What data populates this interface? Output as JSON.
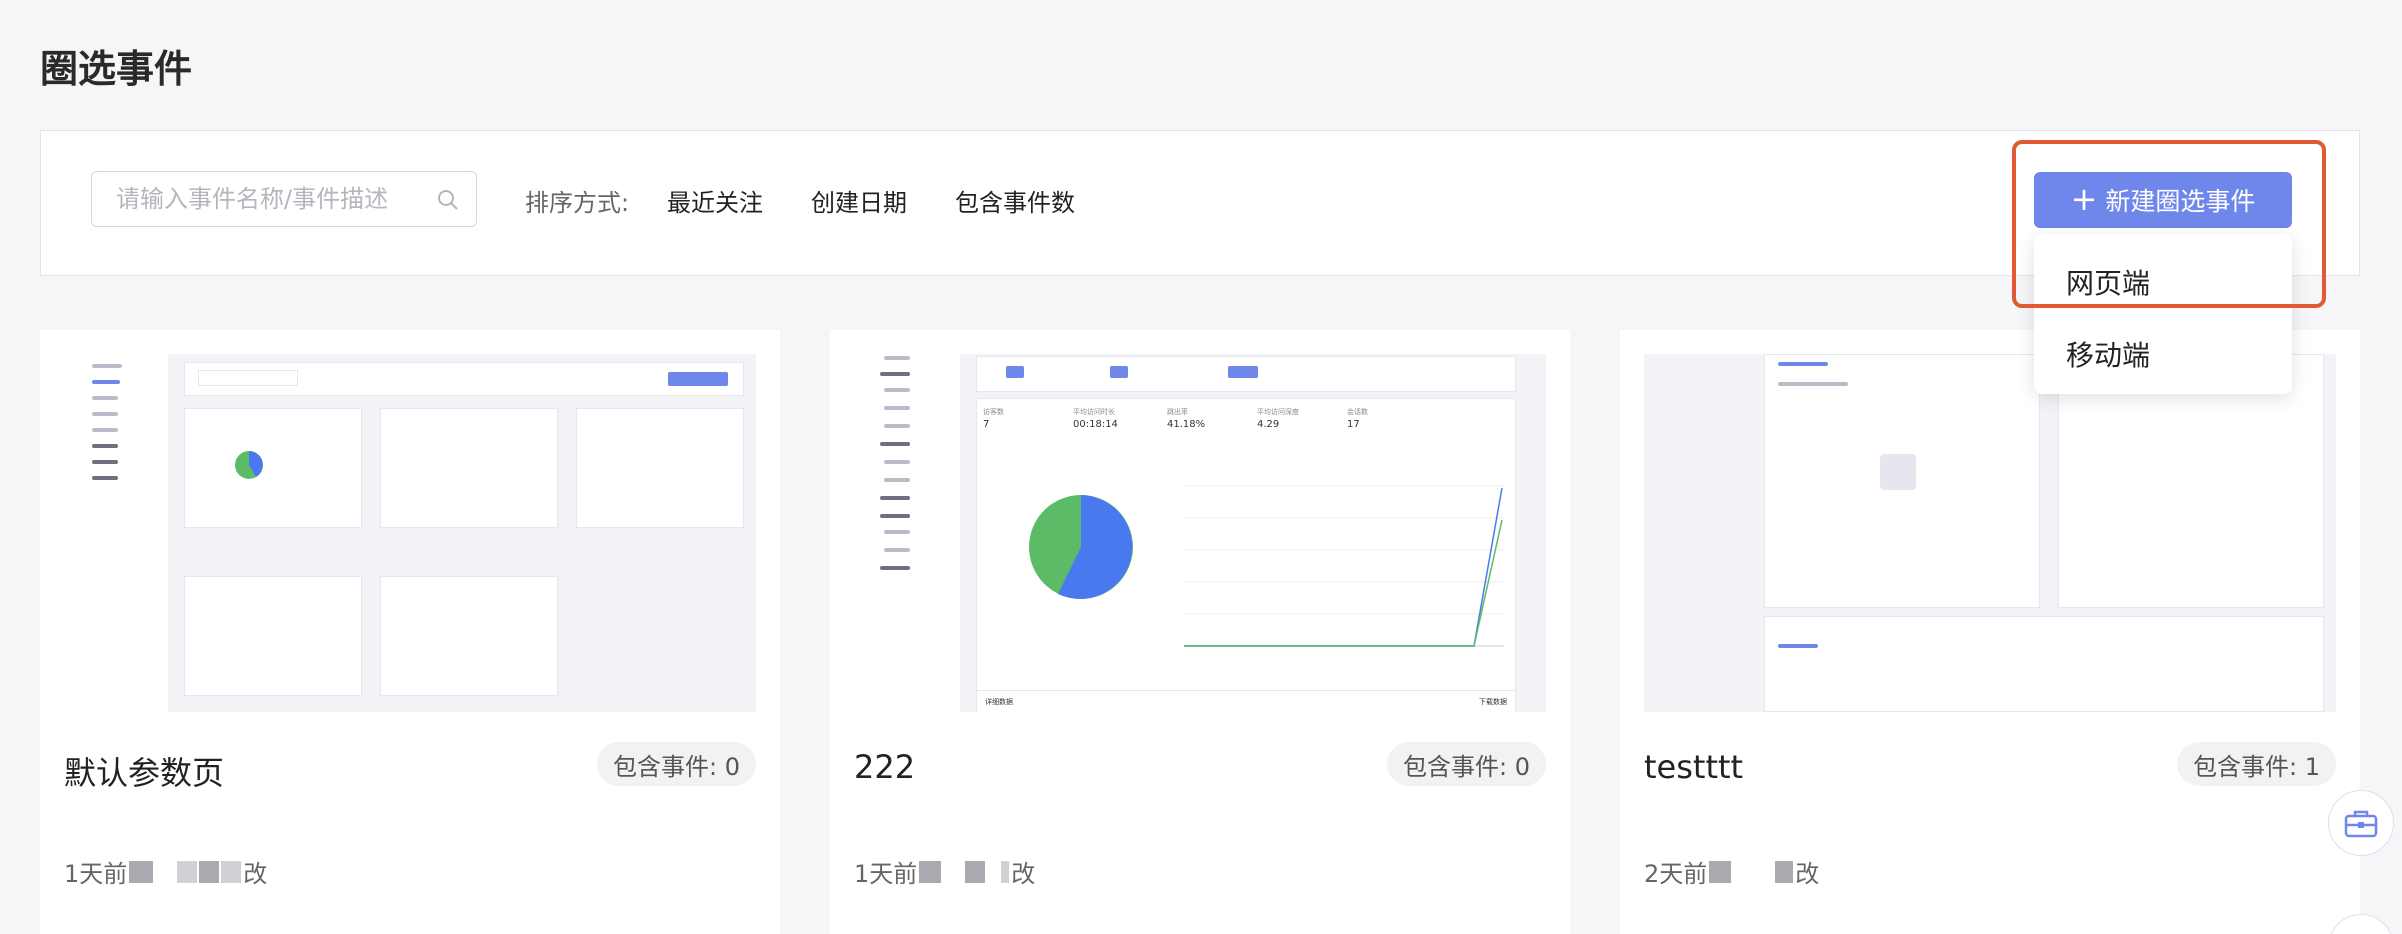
{
  "page": {
    "title": "圈选事件"
  },
  "toolbar": {
    "search_placeholder": "请输入事件名称/事件描述",
    "sort_label": "排序方式:",
    "sort_options": [
      "最近关注",
      "创建日期",
      "包含事件数"
    ],
    "new_button_label": "新建圈选事件",
    "dropdown_items": [
      "网页端",
      "移动端"
    ]
  },
  "cards": [
    {
      "title": "默认参数页",
      "badge": "包含事件: 0",
      "meta_prefix": "1天前",
      "meta_suffix": "改"
    },
    {
      "title": "222",
      "badge": "包含事件: 0",
      "meta_prefix": "1天前",
      "meta_suffix": "改"
    },
    {
      "title": "testttt",
      "badge": "包含事件: 1",
      "meta_prefix": "2天前",
      "meta_suffix": "改"
    }
  ],
  "thumb2": {
    "stats_labels": [
      "访客数",
      "平均访问时长",
      "跳出率",
      "平均访问深度",
      "会话数"
    ],
    "stats_values": [
      "7",
      "00:18:14",
      "41.18%",
      "4.29",
      "17"
    ],
    "footer_left": "详细数据",
    "footer_right": "下载数据"
  },
  "colors": {
    "accent": "#6f87ea",
    "highlight": "#e25a33",
    "pie_blue": "#4a78ef",
    "pie_green": "#5cbb67"
  }
}
